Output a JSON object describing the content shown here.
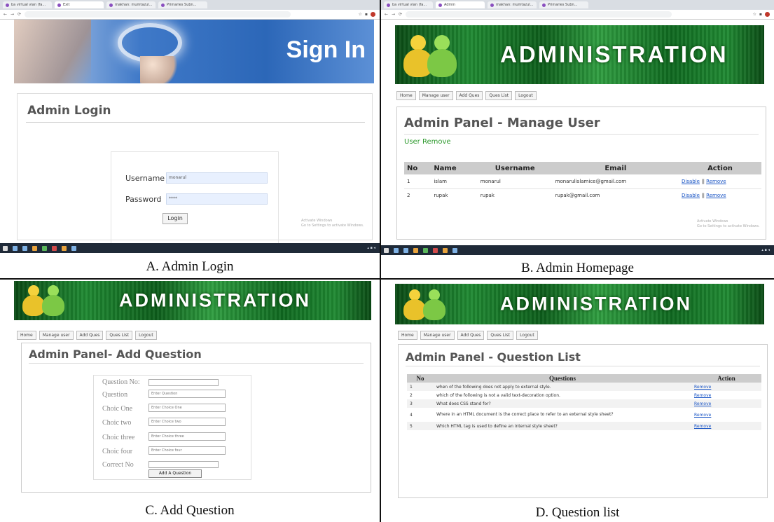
{
  "captions": {
    "a": "A. Admin Login",
    "b": "B. Admin Homepage",
    "c": "C. Add Question",
    "d": "D. Question list"
  },
  "browser": {
    "tabs_a": [
      "ba virtual vlan (fa...",
      "Exit",
      "makhan: mumtazul...",
      "Primaries Subn..."
    ],
    "tabs_b": [
      "ba virtual vlan (fa...",
      "Admin",
      "makhan: mumtazul...",
      "Primaries Subn..."
    ]
  },
  "signin": {
    "banner_title": "Sign In",
    "heading": "Admin Login",
    "username_label": "Username",
    "username_value": "monarul",
    "password_label": "Password",
    "password_value": "****",
    "login_button": "Login",
    "watermark_1": "Activate Windows",
    "watermark_2": "Go to Settings to activate Windows."
  },
  "admin": {
    "banner_title": "ADMINISTRATION",
    "nav": [
      "Home",
      "Manage user",
      "Add Ques",
      "Ques List",
      "Logout"
    ]
  },
  "manage_user": {
    "title": "Admin Panel - Manage User",
    "status": "User Remove",
    "columns": [
      "No",
      "Name",
      "Username",
      "Email",
      "Action"
    ],
    "rows": [
      {
        "no": "1",
        "name": "islam",
        "username": "monarul",
        "email": "monarulislamice@gmail.com",
        "disable": "Disable",
        "sep": "||",
        "remove": "Remove"
      },
      {
        "no": "2",
        "name": "rupak",
        "username": "rupak",
        "email": "rupak@gmail.com",
        "disable": "Disable",
        "sep": "||",
        "remove": "Remove"
      }
    ],
    "watermark_1": "Activate Windows",
    "watermark_2": "Go to Settings to activate Windows."
  },
  "add_question": {
    "title": "Admin Panel- Add Question",
    "labels": [
      "Question No:",
      "Question",
      "Choic One",
      "Choic two",
      "Choic three",
      "Choic four",
      "Correct No"
    ],
    "placeholders": [
      "",
      "Enter Question",
      "Enter Choice One",
      "Enter Choice two",
      "Enter Choice three",
      "Enter Choice four",
      ""
    ],
    "button": "Add A Question"
  },
  "question_list": {
    "title": "Admin Panel - Question List",
    "columns": [
      "No",
      "Questions",
      "Action"
    ],
    "rows": [
      {
        "no": "1",
        "q": "when of the following does not apply to external style.",
        "action": "Remove"
      },
      {
        "no": "2",
        "q": "which of the following is not a valid text-decoration option.",
        "action": "Remove"
      },
      {
        "no": "3",
        "q": "What does CSS stand for?",
        "action": "Remove"
      },
      {
        "no": "4",
        "q": "Where in an HTML document is the correct place to refer to an external style sheet?",
        "action": "Remove"
      },
      {
        "no": "5",
        "q": "Which HTML tag is used to define an internal style sheet?",
        "action": "Remove"
      }
    ]
  },
  "colors": {
    "banner_green": "#1f8a32",
    "signin_blue": "#2c67b8",
    "link_blue": "#1a55c5",
    "status_green": "#2e9a2e"
  }
}
